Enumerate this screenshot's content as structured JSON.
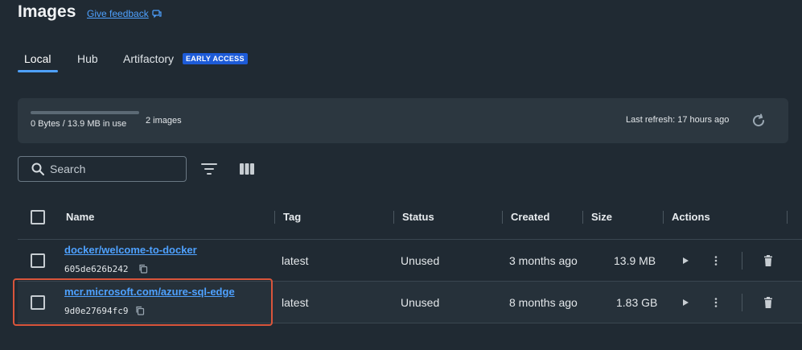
{
  "header": {
    "title": "Images",
    "feedback_label": "Give feedback"
  },
  "tabs": [
    {
      "label": "Local",
      "active": true
    },
    {
      "label": "Hub",
      "active": false
    },
    {
      "label": "Artifactory",
      "active": false,
      "badge": "EARLY ACCESS"
    }
  ],
  "usage": {
    "text": "0 Bytes / 13.9 MB in use",
    "fraction": 0,
    "image_count": "2 images",
    "last_refresh": "Last refresh: 17 hours ago"
  },
  "search": {
    "placeholder": "Search",
    "value": ""
  },
  "table": {
    "columns": [
      "Name",
      "Tag",
      "Status",
      "Created",
      "Size",
      "Actions"
    ],
    "rows": [
      {
        "name": "docker/welcome-to-docker",
        "id": "605de626b242",
        "tag": "latest",
        "status": "Unused",
        "created": "3 months ago",
        "size": "13.9 MB"
      },
      {
        "name": "mcr.microsoft.com/azure-sql-edge",
        "id": "9d0e27694fc9",
        "tag": "latest",
        "status": "Unused",
        "created": "8 months ago",
        "size": "1.83 GB"
      }
    ]
  },
  "icons": {
    "feedback": "chat-bubble-icon",
    "refresh": "refresh-icon",
    "search": "search-icon",
    "filter": "filter-icon",
    "columns": "columns-icon",
    "copy": "copy-icon",
    "run": "play-icon",
    "more": "more-vertical-icon",
    "delete": "trash-icon"
  },
  "colors": {
    "background": "#202a33",
    "accent": "#4ea1ff",
    "badge": "#1d5bd8",
    "highlight": "#d9553b"
  }
}
